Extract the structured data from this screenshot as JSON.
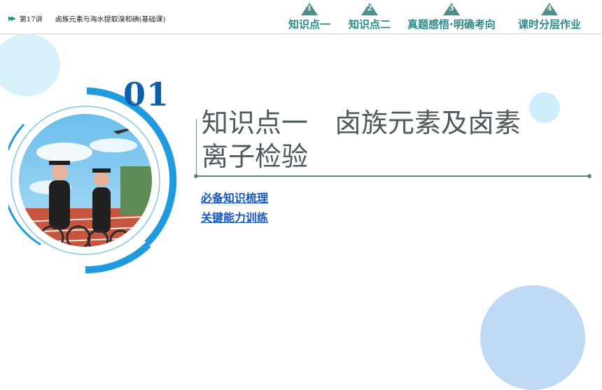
{
  "header": {
    "lesson": "第17讲",
    "lesson_title": "卤族元素与海水提取溴和碘(基础课)",
    "nav": [
      {
        "num": "1",
        "label": "知识点一"
      },
      {
        "num": "2",
        "label": "知识点二"
      },
      {
        "num": "3",
        "label": "真题感悟·明确考向"
      },
      {
        "num": "4",
        "label": "课时分层作业"
      }
    ]
  },
  "section": {
    "number": "01",
    "title": "知识点一　卤族元素及卤素\n离子检验"
  },
  "links": {
    "first": "必备知识梳理",
    "second": "关键能力训练"
  },
  "colors": {
    "accent": "#2a8a86",
    "link": "#1556c7",
    "number": "#0b5fa8",
    "ring": "#1e9be0"
  },
  "icons": [
    "double-arrow-icon",
    "triangle-marker-icon"
  ]
}
